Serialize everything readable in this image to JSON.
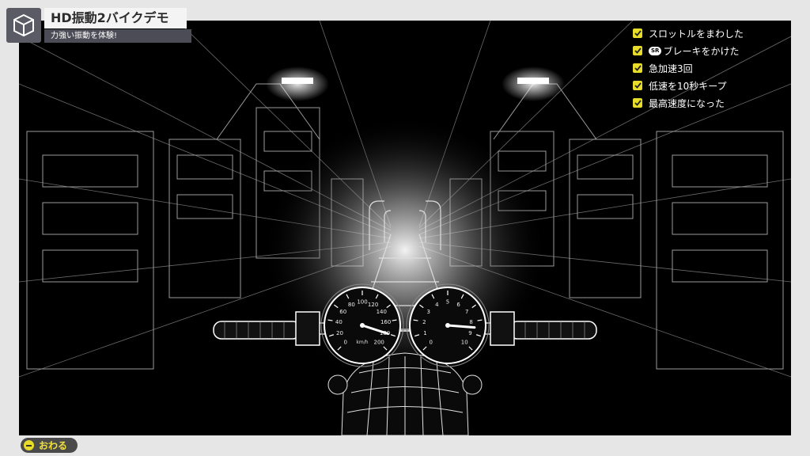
{
  "header": {
    "title": "HD振動2バイクデモ",
    "subtitle": "力強い振動を体験!",
    "icon": "cube-icon"
  },
  "checklist": {
    "items": [
      {
        "label": "スロットルをまわした",
        "checked": true,
        "badge": ""
      },
      {
        "label": "ブレーキをかけた",
        "checked": true,
        "badge": "SR"
      },
      {
        "label": "急加速3回",
        "checked": true,
        "badge": ""
      },
      {
        "label": "低速を10秒キープ",
        "checked": true,
        "badge": ""
      },
      {
        "label": "最高速度になった",
        "checked": true,
        "badge": ""
      }
    ]
  },
  "speedometer": {
    "unit": "km/h",
    "ticks": [
      "0",
      "20",
      "40",
      "60",
      "80",
      "100",
      "120",
      "140",
      "160",
      "180",
      "200"
    ],
    "needle_value": 180
  },
  "tachometer": {
    "ticks": [
      "0",
      "1",
      "2",
      "3",
      "4",
      "5",
      "6",
      "7",
      "8",
      "9",
      "10"
    ],
    "needle_value": 8.5
  },
  "footer": {
    "end_button_label": "おわる"
  },
  "colors": {
    "accent": "#e8dc2a",
    "scene_background": "#000000",
    "frame": "#e6e6e6"
  }
}
